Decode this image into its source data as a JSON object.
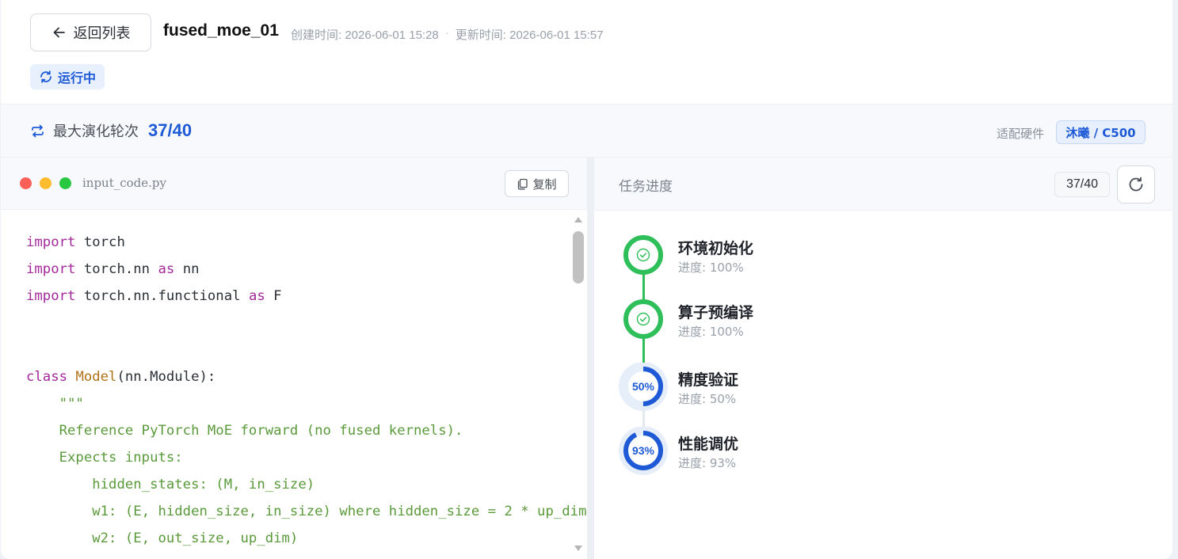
{
  "header": {
    "back_label": "返回列表",
    "title": "fused_moe_01",
    "created": "创建时间: 2026-06-01 15:28",
    "separator": "·",
    "updated": "更新时间: 2026-06-01 15:57",
    "status": "运行中"
  },
  "evolution": {
    "label": "最大演化轮次",
    "value": "37/40",
    "hardware_label": "适配硬件",
    "hardware_value": "沐曦 / C500"
  },
  "code": {
    "filename": "input_code.py",
    "copy_label": "复制",
    "lines": [
      [
        {
          "t": "import",
          "c": "kw"
        },
        {
          "t": " torch",
          "c": ""
        }
      ],
      [
        {
          "t": "import",
          "c": "kw"
        },
        {
          "t": " torch.nn ",
          "c": ""
        },
        {
          "t": "as",
          "c": "kw"
        },
        {
          "t": " nn",
          "c": ""
        }
      ],
      [
        {
          "t": "import",
          "c": "kw"
        },
        {
          "t": " torch.nn.functional ",
          "c": ""
        },
        {
          "t": "as",
          "c": "kw"
        },
        {
          "t": " F",
          "c": ""
        }
      ],
      [],
      [],
      [
        {
          "t": "class",
          "c": "kw"
        },
        {
          "t": " ",
          "c": ""
        },
        {
          "t": "Model",
          "c": "cls"
        },
        {
          "t": "(nn.Module):",
          "c": ""
        }
      ],
      [
        {
          "t": "    \"\"\"",
          "c": "str"
        }
      ],
      [
        {
          "t": "    Reference PyTorch MoE forward (no fused kernels).",
          "c": "str"
        }
      ],
      [
        {
          "t": "    Expects inputs:",
          "c": "str"
        }
      ],
      [
        {
          "t": "        hidden_states: (M, in_size)",
          "c": "str"
        }
      ],
      [
        {
          "t": "        w1: (E, hidden_size, in_size) where hidden_size = 2 * up_dim",
          "c": "str"
        }
      ],
      [
        {
          "t": "        w2: (E, out_size, up_dim)",
          "c": "str"
        }
      ]
    ]
  },
  "tasks": {
    "title": "任务进度",
    "count": "37/40",
    "steps": [
      {
        "name": "环境初始化",
        "progress_text": "进度: 100%",
        "progress": 100,
        "done": true
      },
      {
        "name": "算子预编译",
        "progress_text": "进度: 100%",
        "progress": 100,
        "done": true
      },
      {
        "name": "精度验证",
        "progress_text": "进度: 50%",
        "progress": 50,
        "done": false,
        "pct_label": "50%"
      },
      {
        "name": "性能调优",
        "progress_text": "进度: 93%",
        "progress": 93,
        "done": false,
        "pct_label": "93%"
      }
    ]
  },
  "colors": {
    "accent": "#1e5ad6",
    "success": "#2fbf5a",
    "ring_bg": "#e6eef9"
  }
}
